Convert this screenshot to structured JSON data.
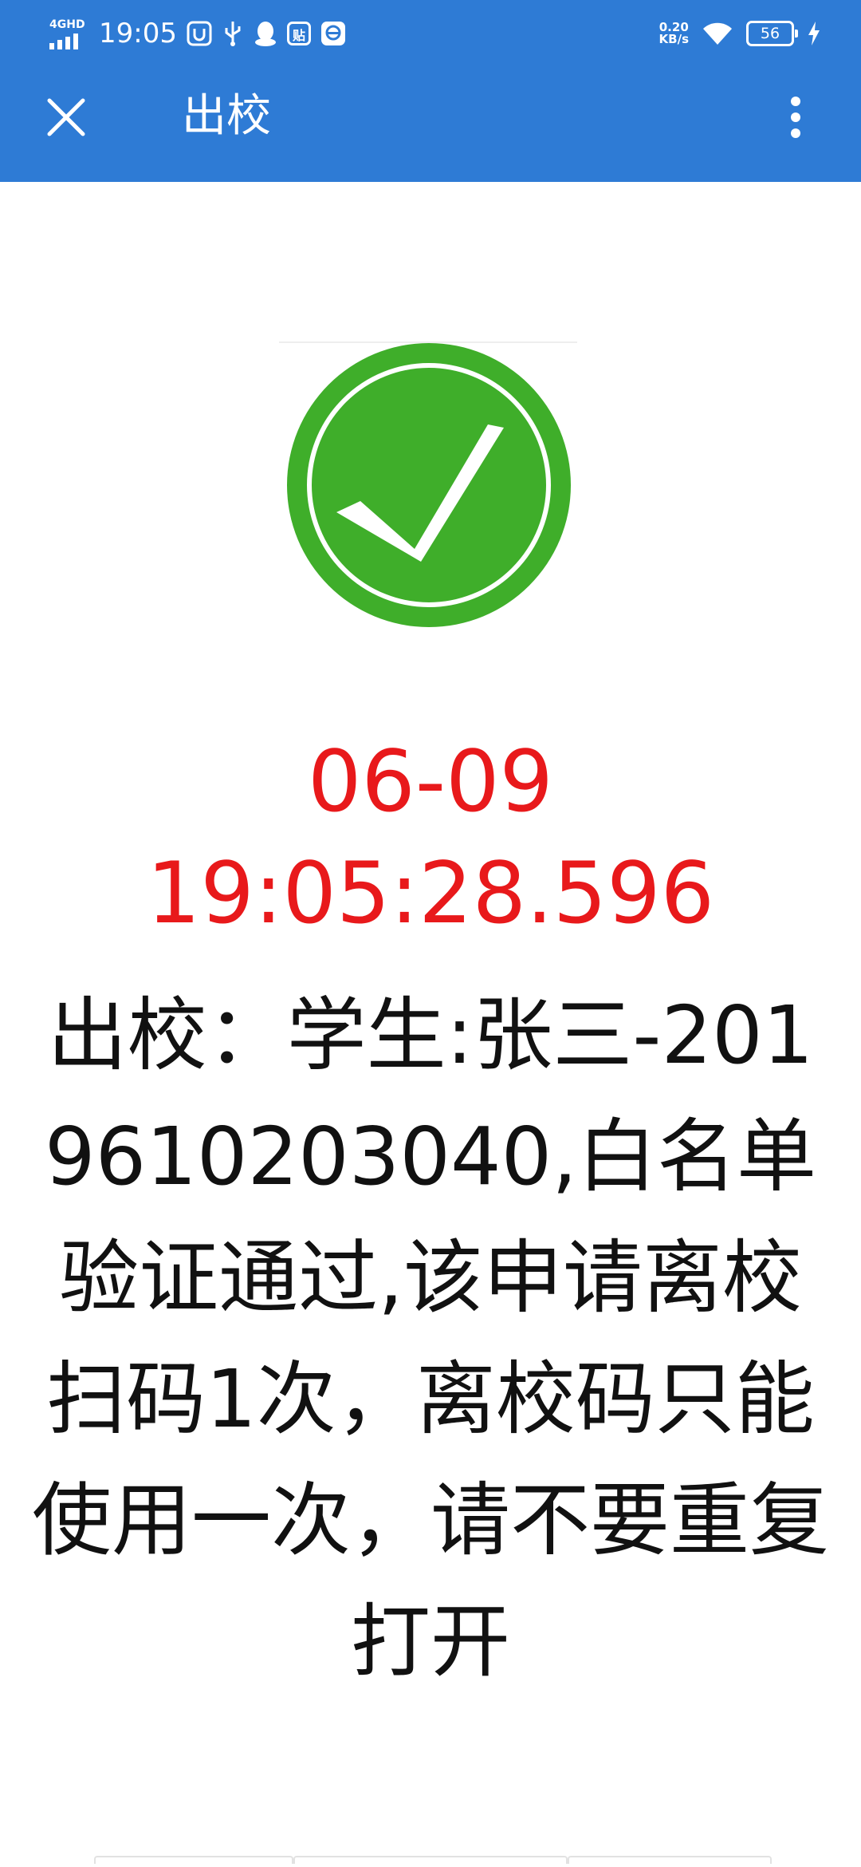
{
  "status_bar": {
    "network": "4GHD",
    "time": "19:05",
    "app_badge": "贴",
    "speed_value": "0.20",
    "speed_unit": "KB/s",
    "battery": "56"
  },
  "toolbar": {
    "title": "出校"
  },
  "result": {
    "date": "06-09",
    "time": "19:05:28.596",
    "message": "出校：学生:张三-2019610203040,白名单验证通过,该申请离校扫码1次，离校码只能使用一次，请不要重复打开"
  },
  "colors": {
    "header": "#2e7bd5",
    "accent_red": "#e8191b",
    "check_green": "#3fae2a"
  }
}
